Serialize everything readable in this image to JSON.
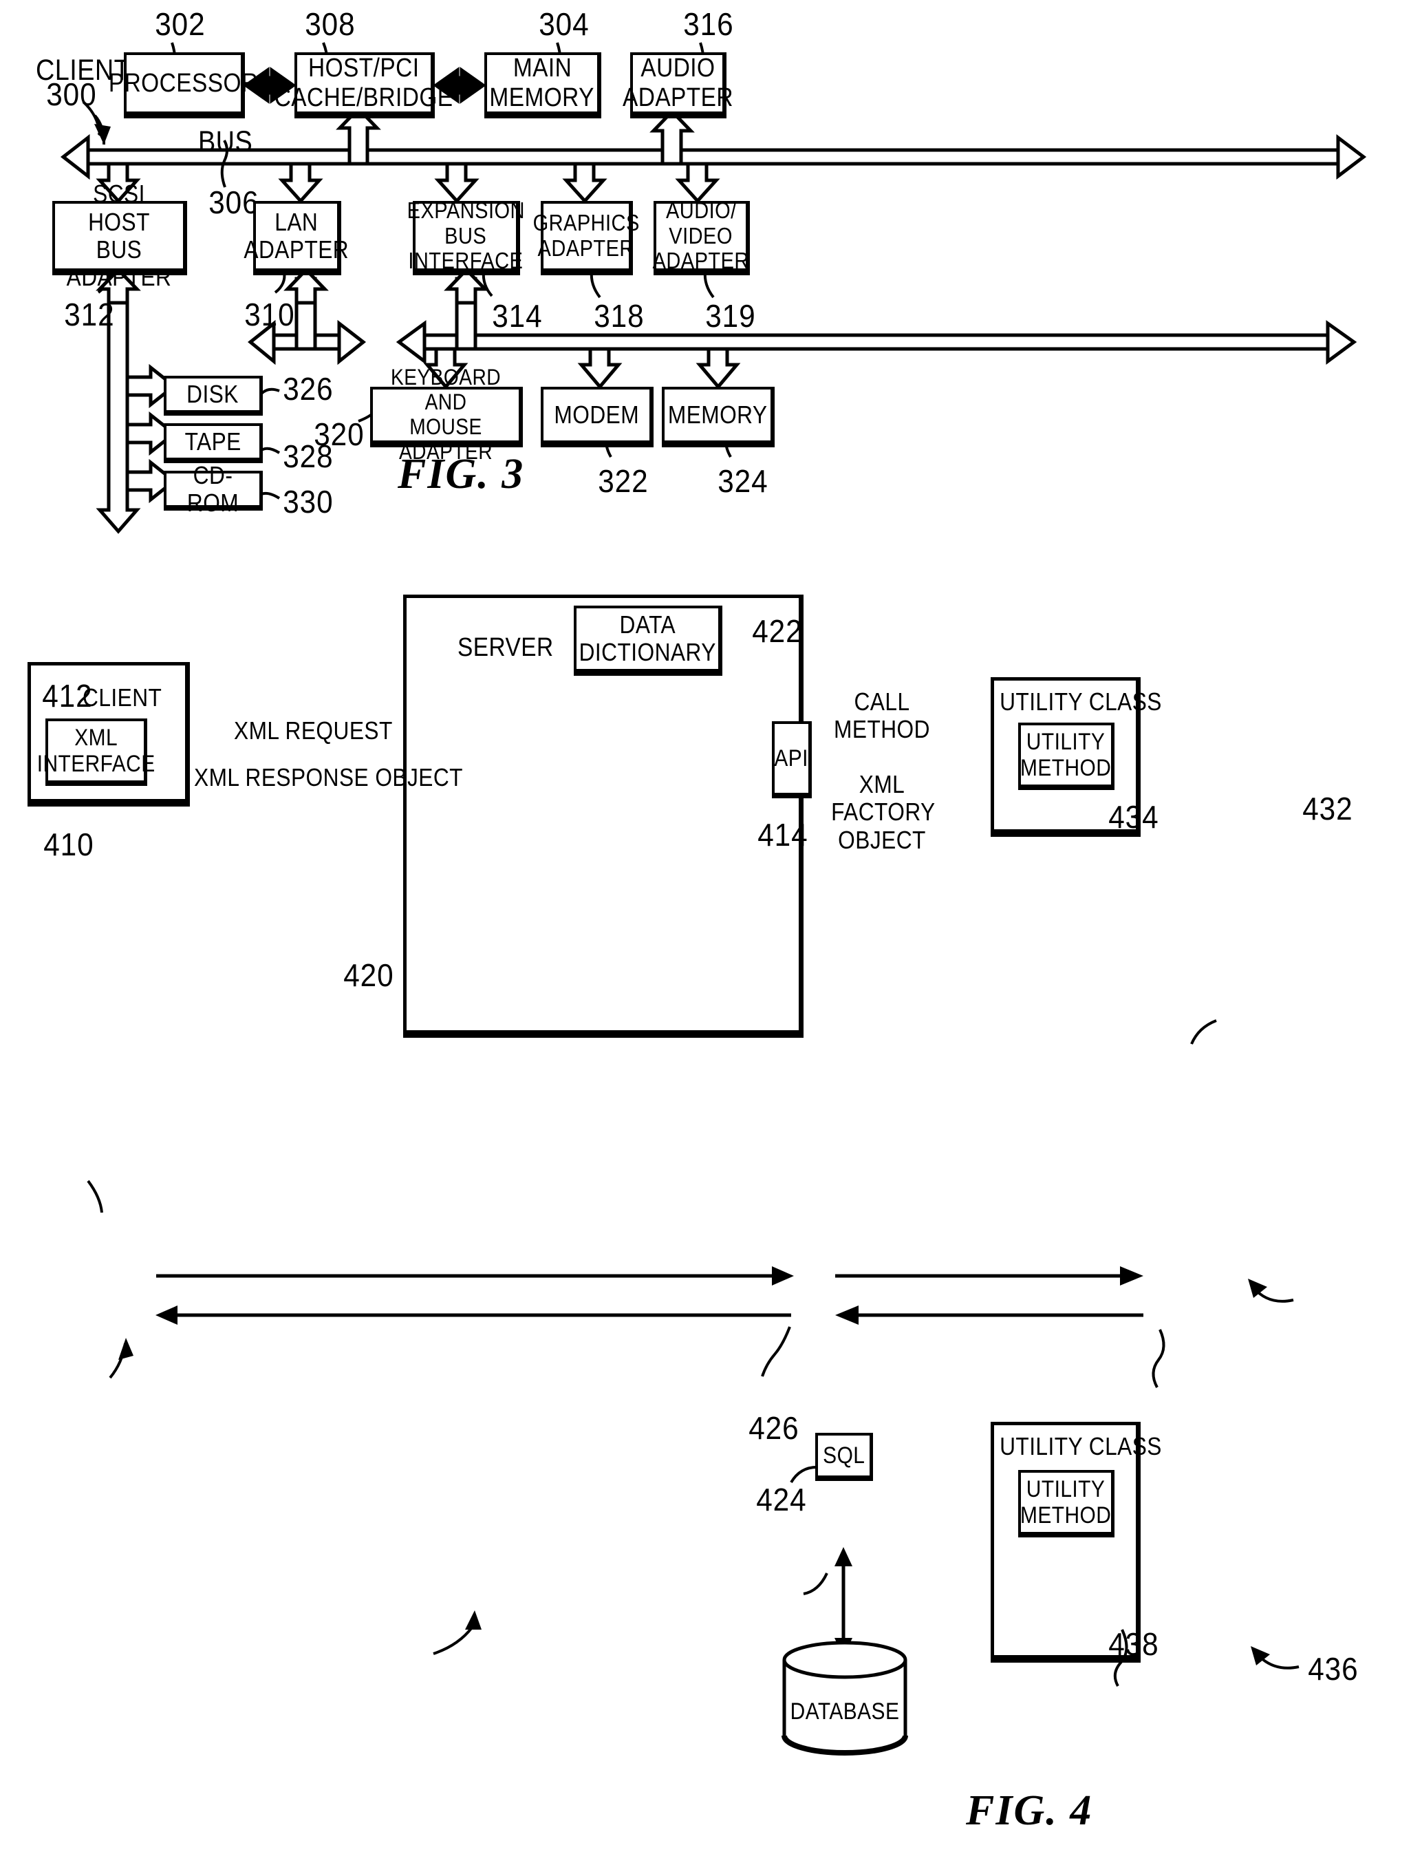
{
  "document": {
    "type": "patent-drawing-sheet",
    "figures": [
      "FIG. 3",
      "FIG. 4"
    ]
  },
  "fig3": {
    "caption": "FIG. 3",
    "system_label": "CLIENT",
    "system_ref": "300",
    "bus_label": "BUS",
    "bus_ref": "306",
    "boxes": [
      {
        "id": "processor",
        "label": "PROCESSOR",
        "ref": "302"
      },
      {
        "id": "host_pci_bridge",
        "label_lines": [
          "HOST/PCI",
          "CACHE/BRIDGE"
        ],
        "ref": "308"
      },
      {
        "id": "main_memory",
        "label_lines": [
          "MAIN",
          "MEMORY"
        ],
        "ref": "304"
      },
      {
        "id": "audio_adapter",
        "label_lines": [
          "AUDIO",
          "ADAPTER"
        ],
        "ref": "316"
      },
      {
        "id": "scsi_host_bus_adapter",
        "label_lines": [
          "SCSI HOST",
          "BUS ADAPTER"
        ],
        "ref": "312"
      },
      {
        "id": "lan_adapter",
        "label_lines": [
          "LAN",
          "ADAPTER"
        ],
        "ref": "310"
      },
      {
        "id": "expansion_bus_interface",
        "label_lines": [
          "EXPANSION",
          "BUS",
          "INTERFACE"
        ],
        "ref": "314"
      },
      {
        "id": "graphics_adapter",
        "label_lines": [
          "GRAPHICS",
          "ADAPTER"
        ],
        "ref": "318"
      },
      {
        "id": "audio_video_adapter",
        "label_lines": [
          "AUDIO/",
          "VIDEO",
          "ADAPTER"
        ],
        "ref": "319"
      },
      {
        "id": "disk",
        "label": "DISK",
        "ref": "326"
      },
      {
        "id": "tape",
        "label": "TAPE",
        "ref": "328"
      },
      {
        "id": "cdrom",
        "label": "CD-ROM",
        "ref": "330"
      },
      {
        "id": "keyboard_mouse_adapter",
        "label_lines": [
          "KEYBOARD AND",
          "MOUSE ADAPTER"
        ],
        "ref": "320"
      },
      {
        "id": "modem",
        "label": "MODEM",
        "ref": "322"
      },
      {
        "id": "memory",
        "label": "MEMORY",
        "ref": "324"
      }
    ]
  },
  "fig4": {
    "caption": "FIG. 4",
    "client": {
      "label": "CLIENT",
      "ref_outer": "410",
      "ref_inner": "412",
      "xml_interface_lines": [
        "XML",
        "INTERFACE"
      ]
    },
    "server": {
      "label": "SERVER",
      "ref": "420",
      "data_dictionary_lines": [
        "DATA",
        "DICTIONARY"
      ],
      "data_dictionary_ref": "422",
      "api_label": "API",
      "api_ref": "414",
      "sql_label": "SQL",
      "sql_ref": "426",
      "database_label": "DATABASE",
      "database_ref": "424",
      "utility_class_1": {
        "label": "UTILITY CLASS",
        "ref": "432",
        "method_lines": [
          "UTILITY",
          "METHOD"
        ],
        "method_ref": "434"
      },
      "utility_class_2": {
        "label": "UTILITY CLASS",
        "ref": "436",
        "method_lines": [
          "UTILITY",
          "METHOD"
        ],
        "method_ref": "438"
      }
    },
    "flows": {
      "xml_request": "XML REQUEST",
      "xml_response_object": "XML RESPONSE OBJECT",
      "call_method_lines": [
        "CALL",
        "METHOD"
      ],
      "xml_factory_object_lines": [
        "XML",
        "FACTORY",
        "OBJECT"
      ]
    }
  },
  "colors": {
    "ink": "#000000",
    "paper": "#ffffff"
  }
}
